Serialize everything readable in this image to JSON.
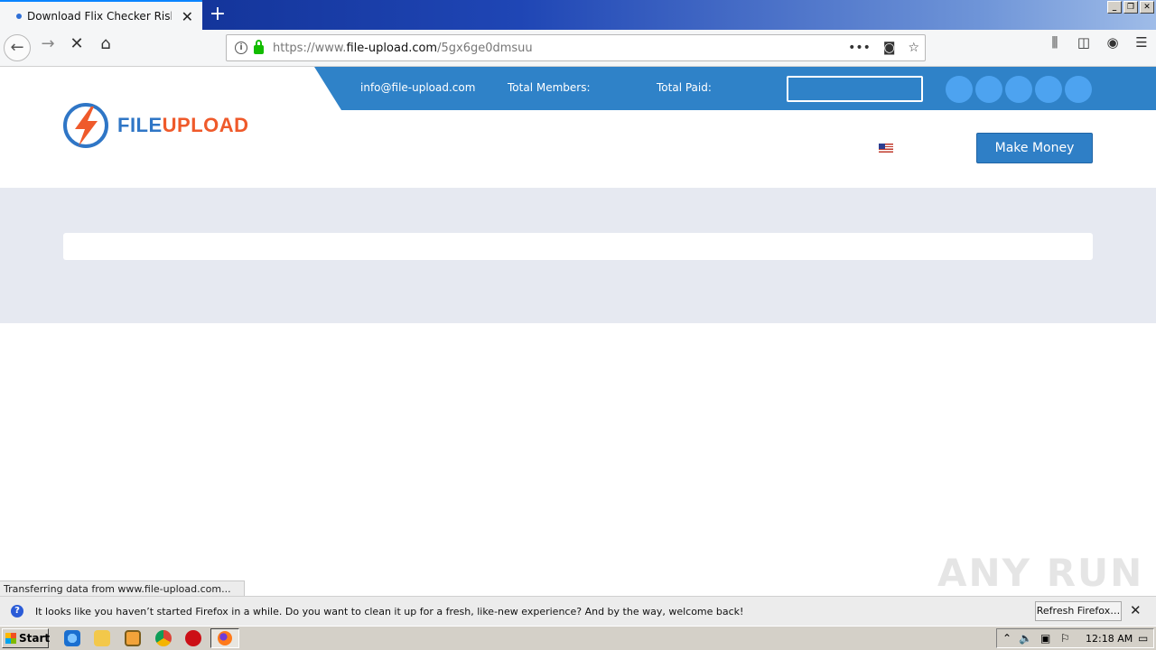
{
  "browser": {
    "tab_title": "Download Flix Checker Risky rar",
    "new_tab_label": "+",
    "url_prefix": "https://www.",
    "url_domain": "file-upload.com",
    "url_path": "/5gx6ge0dmsuu",
    "page_actions_label": "•••",
    "pocket_icon": "pocket-icon",
    "bookmark_icon": "star-icon"
  },
  "site": {
    "email": "info@file-upload.com",
    "total_members_label": "Total Members:",
    "total_paid_label": "Total Paid:",
    "logo_part1": "FILE",
    "logo_part2": "UPLOAD",
    "make_money_label": "Make Money",
    "colors": {
      "primary": "#2f82c8",
      "accent": "#ef5a2b",
      "band": "#e6e9f1"
    }
  },
  "status_text": "Transferring data from www.file-upload.com...",
  "watermark": "ANY RUN",
  "notification": {
    "message": "It looks like you haven’t started Firefox in a while. Do you want to clean it up for a fresh, like-new experience? And by the way, welcome back!",
    "button_label": "Refresh Firefox…"
  },
  "taskbar": {
    "start_label": "Start",
    "clock": "12:18 AM"
  }
}
